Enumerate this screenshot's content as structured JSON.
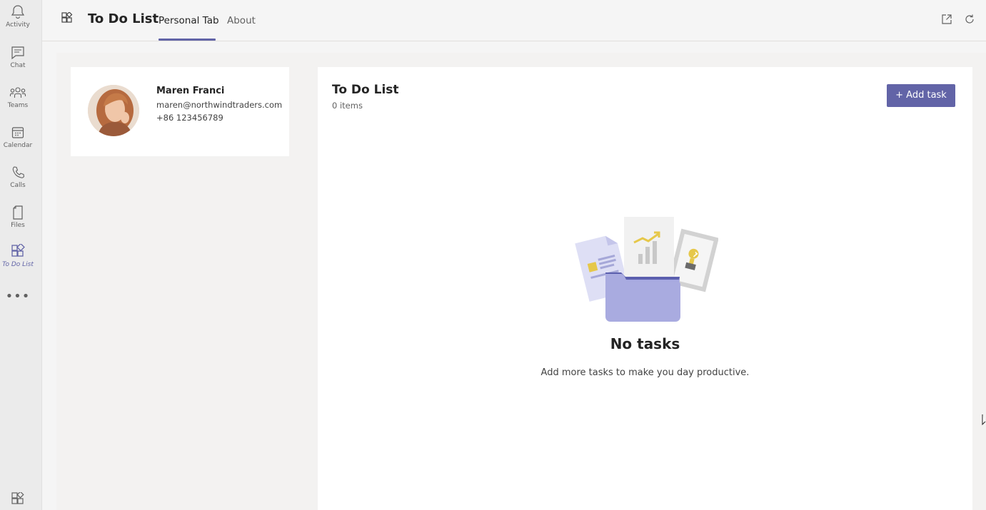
{
  "rail": {
    "items": [
      {
        "label": "Activity",
        "icon": "bell-icon"
      },
      {
        "label": "Chat",
        "icon": "chat-icon"
      },
      {
        "label": "Teams",
        "icon": "teams-icon"
      },
      {
        "label": "Calendar",
        "icon": "calendar-icon"
      },
      {
        "label": "Calls",
        "icon": "phone-icon"
      },
      {
        "label": "Files",
        "icon": "file-icon"
      },
      {
        "label": "To Do List",
        "icon": "apps-icon",
        "active": true
      }
    ],
    "more_icon": "more-icon",
    "apps_icon": "apps-icon"
  },
  "header": {
    "app_icon": "apps-icon",
    "title": "To Do List",
    "tabs": [
      {
        "label": "Personal Tab",
        "active": true
      },
      {
        "label": "About",
        "active": false
      }
    ],
    "actions": [
      "popout-icon",
      "refresh-icon"
    ]
  },
  "profile": {
    "name": "Maren Franci",
    "email": "maren@northwindtraders.com",
    "phone": "+86 123456789"
  },
  "todo": {
    "title": "To Do List",
    "count": "0 items",
    "add_button": "+ Add task",
    "empty_title": "No tasks",
    "empty_description": "Add more tasks to make you day productive."
  },
  "colors": {
    "accent": "#6264a7",
    "rail_bg": "#ebebeb",
    "content_bg": "#f3f2f1"
  }
}
